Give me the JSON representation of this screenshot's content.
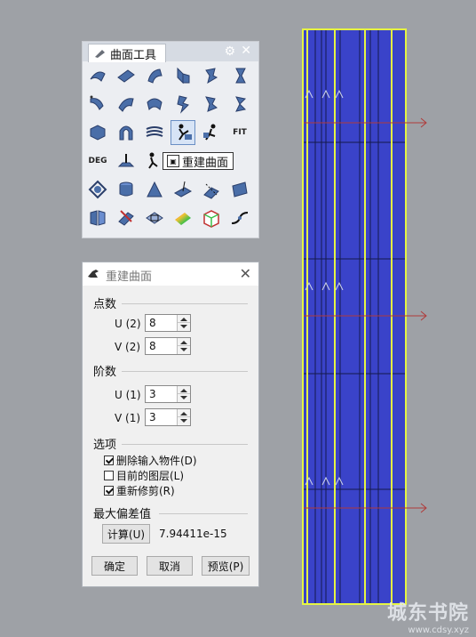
{
  "toolbar": {
    "tab_label": "曲面工具",
    "tools": [
      "surface-tool-icon",
      "surface-tool-icon",
      "surface-tool-icon",
      "surface-tool-icon",
      "surface-tool-icon",
      "surface-tool-icon",
      "surface-tool-icon",
      "surface-tool-icon",
      "surface-tool-icon",
      "surface-tool-icon",
      "surface-tool-icon",
      "surface-tool-icon",
      "surface-tool-icon",
      "surface-tool-icon",
      "surface-tool-icon",
      "rebuild-surface-icon",
      "surface-tool-icon",
      "surface-tool-icon"
    ],
    "deg_label": "DEG",
    "fit_label": "FIT",
    "tooltip": "重建曲面"
  },
  "dialog": {
    "title": "重建曲面",
    "points_section": "点数",
    "u_points_label": "U (2)",
    "u_points_value": "8",
    "v_points_label": "V (2)",
    "v_points_value": "8",
    "degree_section": "阶数",
    "u_degree_label": "U (1)",
    "u_degree_value": "3",
    "v_degree_label": "V (1)",
    "v_degree_value": "3",
    "options_section": "选项",
    "opt_delete_input": "删除输入物件(D)",
    "opt_delete_checked": true,
    "opt_current_layer": "目前的图层(L)",
    "opt_current_layer_checked": false,
    "opt_retrim": "重新修剪(R)",
    "opt_retrim_checked": true,
    "max_deviation_section": "最大偏差值",
    "calc_button": "计算(U)",
    "deviation_value": "7.94411e-15",
    "ok_button": "确定",
    "cancel_button": "取消",
    "preview_button": "预览(P)"
  },
  "watermark": {
    "big": "城东书院",
    "small": "www.cdsy.xyz"
  },
  "colors": {
    "surface_fill": "#3a43c9",
    "surface_edge": "#e6f542",
    "arrow": "#b03a3a",
    "canvas": "#9ea1a6"
  }
}
